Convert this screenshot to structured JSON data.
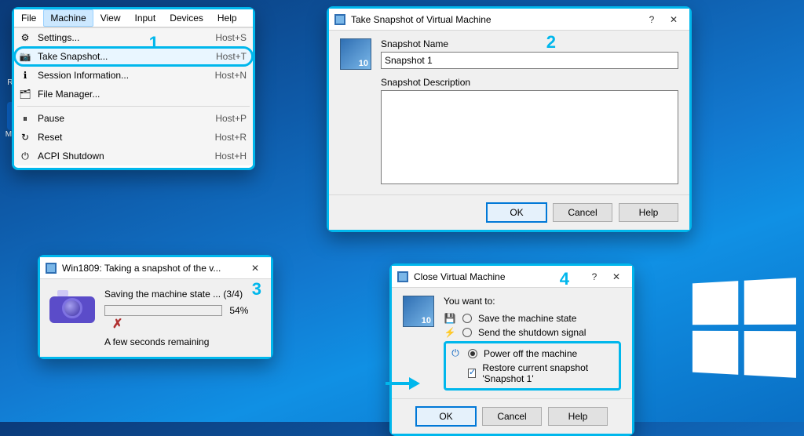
{
  "desktop": {
    "icons": [
      {
        "label": "Recycle Bin"
      },
      {
        "label": "Microsoft Edge"
      }
    ]
  },
  "step_labels": {
    "s1": "1",
    "s2": "2",
    "s3": "3",
    "s4": "4"
  },
  "menubar": {
    "items": [
      "File",
      "Machine",
      "View",
      "Input",
      "Devices",
      "Help"
    ],
    "selected_index": 1
  },
  "machine_menu": [
    {
      "icon": "⚙",
      "label": "Settings...",
      "shortcut": "Host+S"
    },
    {
      "icon": "📷",
      "label": "Take Snapshot...",
      "shortcut": "Host+T",
      "highlight": true
    },
    {
      "icon": "ℹ",
      "label": "Session Information...",
      "shortcut": "Host+N"
    },
    {
      "icon": "🗂",
      "label": "File Manager...",
      "shortcut": ""
    },
    {
      "sep": true
    },
    {
      "icon": "⏸",
      "label": "Pause",
      "shortcut": "Host+P"
    },
    {
      "icon": "↻",
      "label": "Reset",
      "shortcut": "Host+R"
    },
    {
      "icon": "⏻",
      "label": "ACPI Shutdown",
      "shortcut": "Host+H"
    }
  ],
  "snapshot_dialog": {
    "title": "Take Snapshot of Virtual Machine",
    "name_label": "Snapshot Name",
    "name_value": "Snapshot 1",
    "desc_label": "Snapshot Description",
    "desc_value": "",
    "buttons": {
      "ok": "OK",
      "cancel": "Cancel",
      "help": "Help"
    }
  },
  "progress_dialog": {
    "title": "Win1809: Taking a snapshot of the v...",
    "status": "Saving the machine state ... (3/4)",
    "percent_text": "54%",
    "percent_value": 54,
    "remaining": "A few seconds remaining"
  },
  "close_dialog": {
    "title": "Close Virtual Machine",
    "prompt": "You want to:",
    "opt_save": "Save the machine state",
    "opt_send": "Send the shutdown signal",
    "opt_power": "Power off the machine",
    "restore": "Restore current snapshot 'Snapshot 1'",
    "buttons": {
      "ok": "OK",
      "cancel": "Cancel",
      "help": "Help"
    }
  }
}
